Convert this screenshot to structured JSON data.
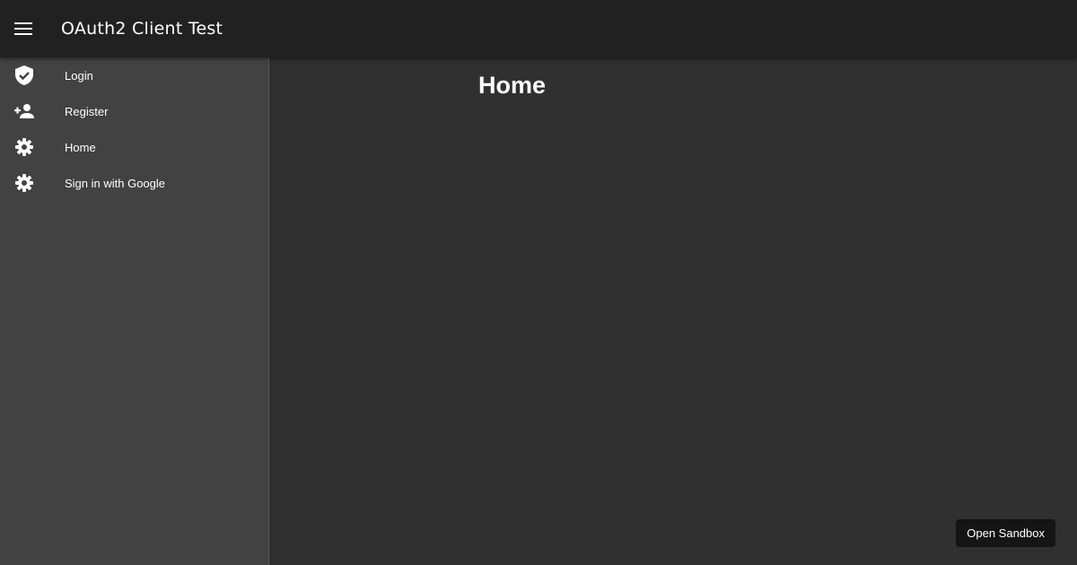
{
  "header": {
    "menu_icon": "menu-icon",
    "title": "OAuth2 Client Test"
  },
  "sidebar": {
    "items": [
      {
        "label": "Login",
        "icon": "verified-shield-icon"
      },
      {
        "label": "Register",
        "icon": "person-add-icon"
      },
      {
        "label": "Home",
        "icon": "gear-icon"
      },
      {
        "label": "Sign in with Google",
        "icon": "gear-icon"
      }
    ]
  },
  "main": {
    "title": "Home"
  },
  "sandbox": {
    "label": "Open Sandbox"
  },
  "colors": {
    "appbar": "#212121",
    "sidebar": "#424242",
    "main_bg": "#303030",
    "text": "#ffffff"
  }
}
